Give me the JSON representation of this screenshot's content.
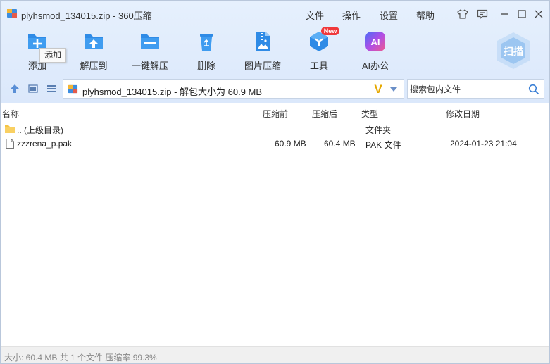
{
  "window": {
    "title": "plyhsmod_134015.zip - 360压缩",
    "menu": [
      "文件",
      "操作",
      "设置",
      "帮助"
    ]
  },
  "toolbar": {
    "items": [
      {
        "label": "添加",
        "icon": "add-icon"
      },
      {
        "label": "解压到",
        "icon": "extract-to-icon"
      },
      {
        "label": "一键解压",
        "icon": "one-click-extract-icon"
      },
      {
        "label": "删除",
        "icon": "delete-icon"
      },
      {
        "label": "图片压缩",
        "icon": "image-compress-icon"
      },
      {
        "label": "工具",
        "icon": "tools-icon"
      },
      {
        "label": "AI办公",
        "icon": "ai-office-icon"
      }
    ],
    "new_badge": "New",
    "ai_glyph": "AI",
    "tooltip": "添加",
    "scan_label": "扫描"
  },
  "addressbar": {
    "path": "plyhsmod_134015.zip - 解包大小为 60.9 MB",
    "v_glyph": "V"
  },
  "search": {
    "placeholder": "搜索包内文件"
  },
  "columns": [
    "名称",
    "压缩前",
    "压缩后",
    "类型",
    "修改日期"
  ],
  "rows": [
    {
      "name": ".. (上级目录)",
      "before": "",
      "after": "",
      "type": "文件夹",
      "modified": "",
      "icon": "folder-icon"
    },
    {
      "name": "zzzrena_p.pak",
      "before": "60.9 MB",
      "after": "60.4 MB",
      "type": "PAK 文件",
      "modified": "2024-01-23 21:04",
      "icon": "file-icon"
    }
  ],
  "status": {
    "text": "大小: 60.4 MB 共 1 个文件 压缩率 99.3%"
  },
  "colors": {
    "accent": "#2f8be6",
    "toolbar_bg": "#dfeafc",
    "new_badge": "#f0383b"
  }
}
